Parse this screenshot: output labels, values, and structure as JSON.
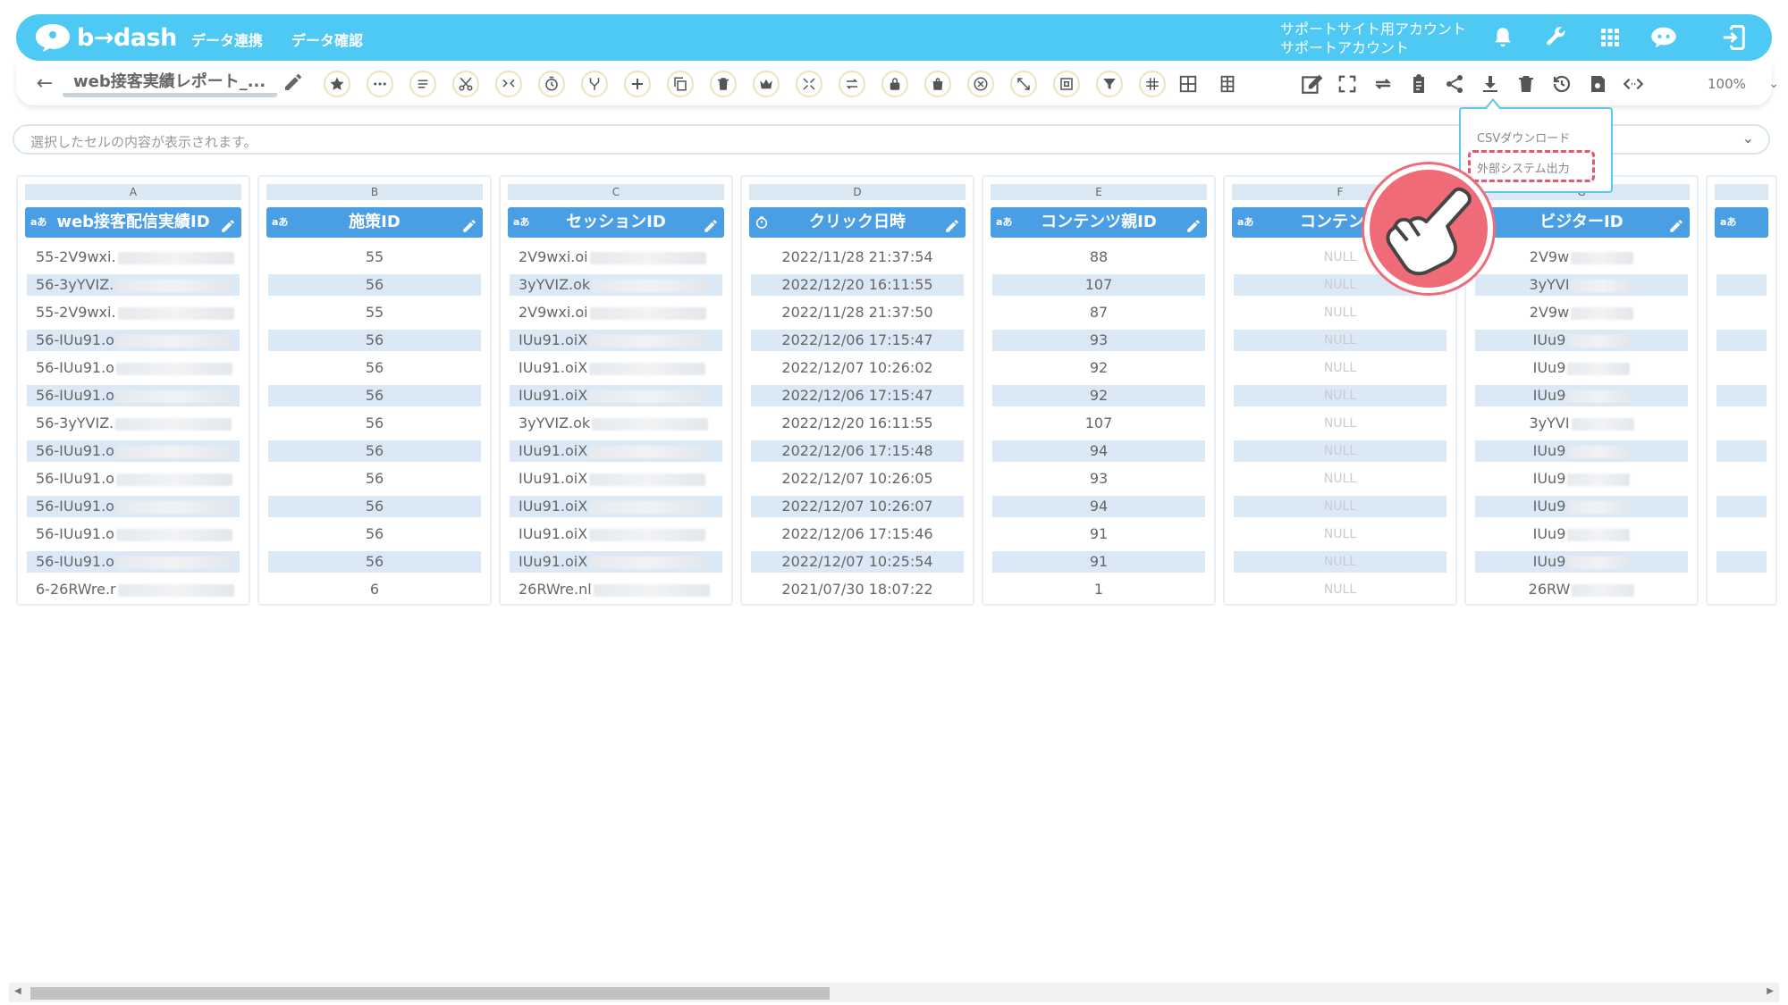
{
  "header": {
    "logo_text": "b→dash",
    "nav": [
      "データ連携",
      "データ確認"
    ],
    "account_line1": "サポートサイト用アカウント",
    "account_line2": "サポートアカウント"
  },
  "toolbar": {
    "back_glyph": "←",
    "report_title": "web接客実績レポート_...",
    "zoom": "100%"
  },
  "popup": {
    "items": [
      "CSVダウンロード",
      "外部システム出力"
    ]
  },
  "cellbar": {
    "placeholder": "選択したセルの内容が表示されます。"
  },
  "columns": [
    {
      "letter": "A",
      "type": "aあ",
      "name": "web接客配信実績ID",
      "align": "left",
      "cells": [
        "55-2V9wxi.",
        "56-3yYVIZ.",
        "55-2V9wxi.",
        "56-IUu91.o",
        "56-IUu91.o",
        "56-IUu91.o",
        "56-3yYVIZ.",
        "56-IUu91.o",
        "56-IUu91.o",
        "56-IUu91.o",
        "56-IUu91.o",
        "56-IUu91.o",
        "6-26RWre.r"
      ]
    },
    {
      "letter": "B",
      "type": "aあ",
      "name": "施策ID",
      "align": "center",
      "cells": [
        "55",
        "56",
        "55",
        "56",
        "56",
        "56",
        "56",
        "56",
        "56",
        "56",
        "56",
        "56",
        "6"
      ]
    },
    {
      "letter": "C",
      "type": "aあ",
      "name": "セッションID",
      "align": "left",
      "cells": [
        "2V9wxi.oi",
        "3yYVIZ.ok",
        "2V9wxi.oi",
        "IUu91.oiX",
        "IUu91.oiX",
        "IUu91.oiX",
        "3yYVIZ.ok",
        "IUu91.oiX",
        "IUu91.oiX",
        "IUu91.oiX",
        "IUu91.oiX",
        "IUu91.oiX",
        "26RWre.nl"
      ]
    },
    {
      "letter": "D",
      "type": "clock",
      "name": "クリック日時",
      "align": "center",
      "cells": [
        "2022/11/28 21:37:54",
        "2022/12/20 16:11:55",
        "2022/11/28 21:37:50",
        "2022/12/06 17:15:47",
        "2022/12/07 10:26:02",
        "2022/12/06 17:15:47",
        "2022/12/20 16:11:55",
        "2022/12/06 17:15:48",
        "2022/12/07 10:26:05",
        "2022/12/07 10:26:07",
        "2022/12/06 17:15:46",
        "2022/12/07 10:25:54",
        "2021/07/30 18:07:22"
      ]
    },
    {
      "letter": "E",
      "type": "aあ",
      "name": "コンテンツ親ID",
      "align": "center",
      "cells": [
        "88",
        "107",
        "87",
        "93",
        "92",
        "92",
        "107",
        "94",
        "93",
        "94",
        "91",
        "91",
        "1"
      ]
    },
    {
      "letter": "F",
      "type": "aあ",
      "name": "コンテンツ",
      "align": "center",
      "cells": [
        "NULL",
        "NULL",
        "NULL",
        "NULL",
        "NULL",
        "NULL",
        "NULL",
        "NULL",
        "NULL",
        "NULL",
        "NULL",
        "NULL",
        "NULL"
      ]
    },
    {
      "letter": "G",
      "type": "aあ",
      "name": "ビジターID",
      "align": "center",
      "cells": [
        "2V9w",
        "3yYVI",
        "2V9w",
        "IUu9",
        "IUu9",
        "IUu9",
        "3yYVI",
        "IUu9",
        "IUu9",
        "IUu9",
        "IUu9",
        "IUu9",
        "26RW"
      ]
    },
    {
      "letter": "",
      "type": "aあ",
      "name": "",
      "align": "center",
      "cells": [
        "",
        "",
        "",
        "",
        "",
        "",
        "",
        "",
        "",
        "",
        "",
        "",
        ""
      ]
    }
  ],
  "colors": {
    "brand": "#4ec9f3",
    "header": "#4a9fe4",
    "alt_row": "#dbe9f6",
    "highlight": "#e8566b"
  },
  "icons": {
    "top": [
      "bell-icon",
      "wrench-icon",
      "apps-grid-icon",
      "chat-bot-icon",
      "logout-icon"
    ],
    "tools": [
      "star-icon",
      "more-dots-icon",
      "text-lines-icon",
      "scissors-icon",
      "merge-icon",
      "timer-icon",
      "branch-icon",
      "plus-icon",
      "copy-icon",
      "trash-icon",
      "crown-icon",
      "expand-icon",
      "swap-icon",
      "lock-icon",
      "bag-icon",
      "cancel-icon",
      "resize-icon",
      "frame-icon",
      "filter-icon",
      "hash-icon",
      "grid-icon",
      "columns-icon"
    ],
    "right": [
      "edit-icon",
      "fullscreen-icon",
      "refresh-icon",
      "clipboard-icon",
      "share-icon",
      "download-icon",
      "delete-icon",
      "history-icon",
      "save-icon",
      "code-icon"
    ]
  }
}
